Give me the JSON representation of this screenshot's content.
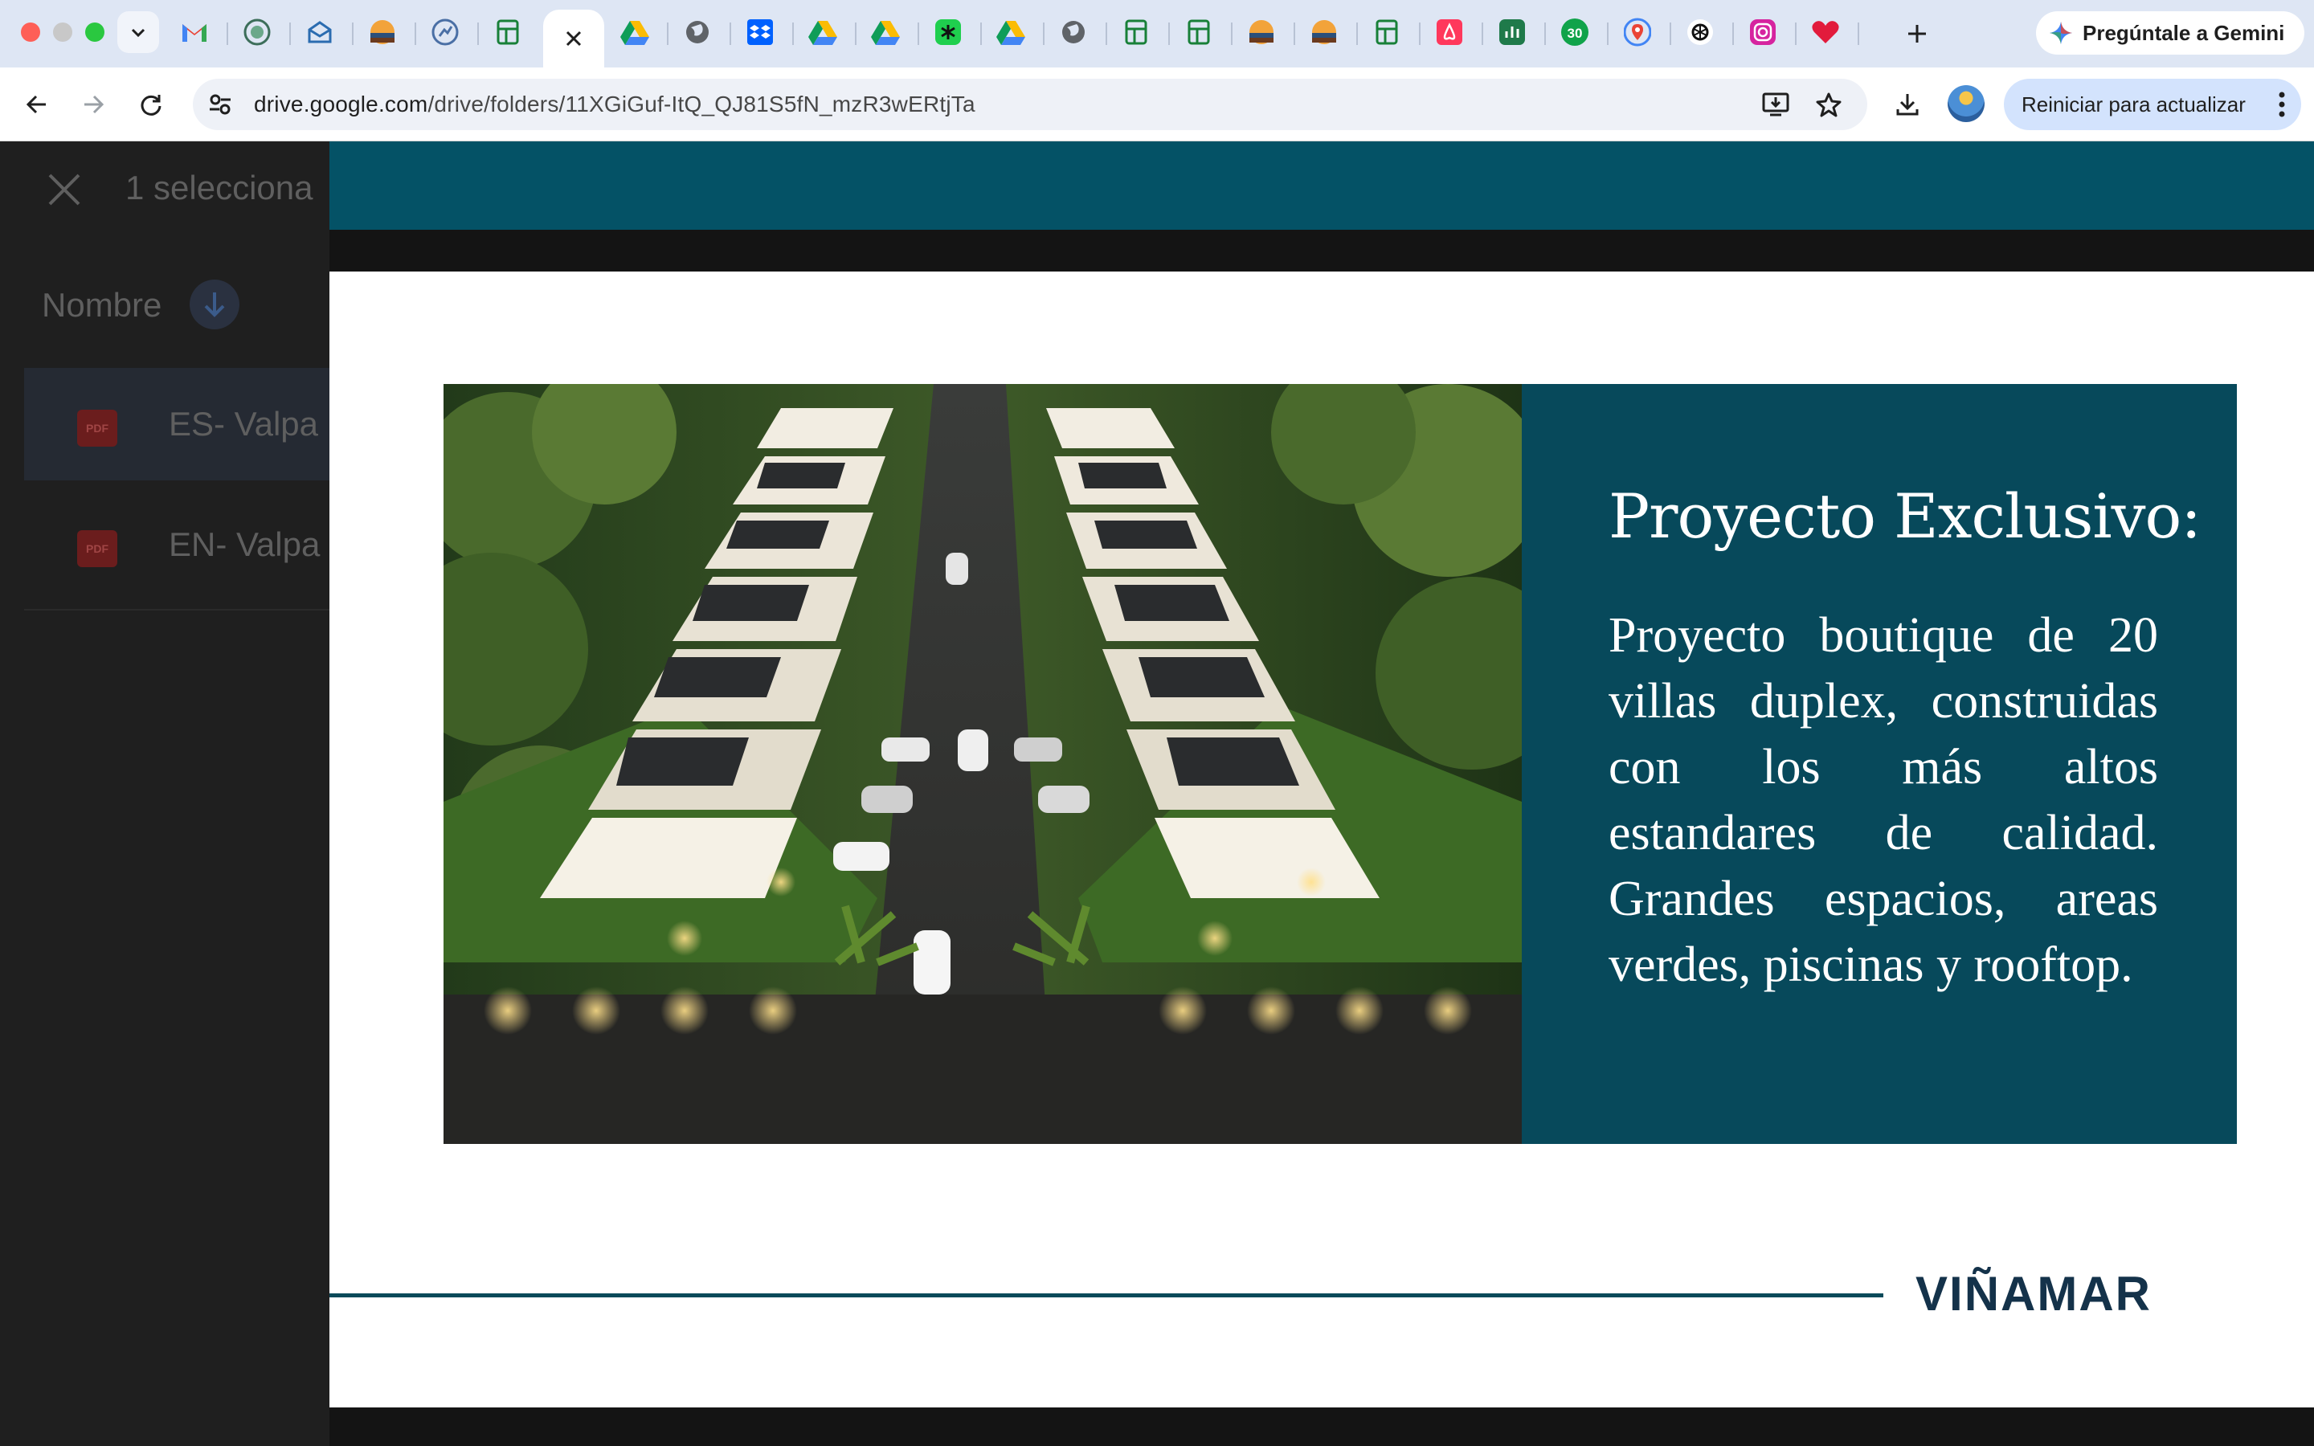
{
  "browser": {
    "url_host": "drive.google.com",
    "url_path": "/drive/folders/11XGiGuf-ItQ_QJ81S5fN_mzR3wERtjTa",
    "gemini_button": "Pregúntale a Gemini",
    "relaunch_button": "Reiniciar para actualizar",
    "tab_badge_30": "30"
  },
  "drive": {
    "selection_text": "1 selecciona",
    "column_header": "Nombre",
    "files": [
      {
        "name": "ES- Valpa",
        "icon": "PDF"
      },
      {
        "name": "EN- Valpa",
        "icon": "PDF"
      }
    ]
  },
  "slide": {
    "title": "Proyecto Exclusivo:",
    "body": "Proyecto boutique de 20 villas duplex, construidas con los más altos estandares de calidad. Grandes espacios, areas verdes, piscinas y rooftop.",
    "logo": "VIÑAMAR"
  },
  "colors": {
    "viewer_header": "#045266",
    "panel": "#07495b",
    "logo": "#14324a",
    "gemini_accent": "#4285f4",
    "relaunch_bg": "#d3e3fd"
  }
}
